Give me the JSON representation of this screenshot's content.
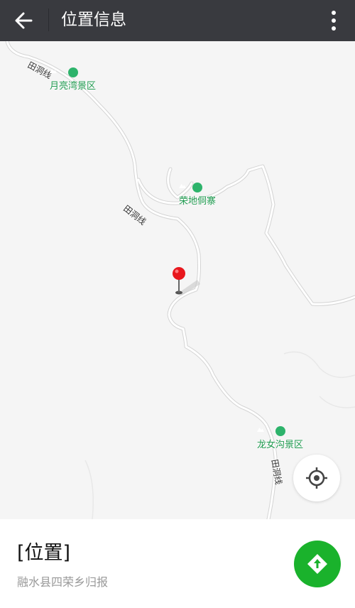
{
  "header": {
    "title": "位置信息",
    "back_icon": "arrow-left-icon",
    "more_icon": "more-vertical-icon"
  },
  "map": {
    "road_labels": [
      "田洞线",
      "田洞线",
      "田洞线"
    ],
    "pois": [
      {
        "name": "月亮湾景区"
      },
      {
        "name": "荣地侗寨"
      },
      {
        "name": "龙女沟景区"
      }
    ],
    "marker_icon": "location-pin-icon",
    "locate_icon": "crosshair-locate-icon"
  },
  "place": {
    "name": "[位置]",
    "address": "融水县四荣乡归报"
  },
  "navigate_icon": "navigate-diamond-icon",
  "colors": {
    "header_bg": "#393a3f",
    "poi_green": "#2db36b",
    "nav_green": "#1ab22c",
    "pin_red": "#e8171d"
  }
}
